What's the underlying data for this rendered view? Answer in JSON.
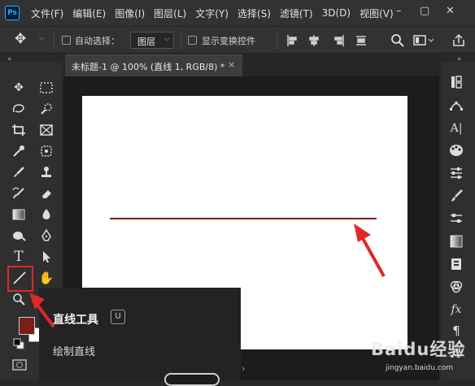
{
  "app": {
    "logo": "Ps"
  },
  "menu": {
    "items": [
      "文件(F)",
      "编辑(E)",
      "图像(I)",
      "图层(L)",
      "文字(Y)",
      "选择(S)",
      "滤镜(T)",
      "3D(D)",
      "视图(V)"
    ],
    "minimize": "–",
    "restore": "▢",
    "close": "✕"
  },
  "options": {
    "auto_select_label": "自动选择：",
    "layer_select_value": "图层",
    "show_transform_label": "显示变换控件"
  },
  "document": {
    "tab_title": "未标题-1 @ 100% (直线 1, RGB/8) *",
    "close_glyph": "×"
  },
  "tooltip": {
    "title": "直线工具",
    "shortcut": "U",
    "description": "绘制直线"
  },
  "colors": {
    "foreground": "#7b1e1a",
    "background": "#ffffff",
    "line": "#8b1a1a",
    "arrow": "#e02828"
  },
  "icons": {
    "left": [
      "move-icon",
      "marquee-icon",
      "lasso-icon",
      "quick-select-icon",
      "crop-icon",
      "frame-icon",
      "eyedropper-icon",
      "spot-heal-icon",
      "brush-icon",
      "stamp-icon",
      "history-brush-icon",
      "eraser-icon",
      "gradient-icon",
      "blur-icon",
      "dodge-icon",
      "pen-icon",
      "type-icon",
      "path-select-icon",
      "line-tool-icon",
      "hand-icon",
      "zoom-icon"
    ],
    "right": [
      "history-icon",
      "paths-icon",
      "character-icon",
      "color-icon",
      "adjust-icon",
      "brushes-icon",
      "properties-icon",
      "gradients-icon",
      "libraries-icon",
      "channels-icon",
      "fx-icon",
      "paragraph-icon",
      "glyphs-icon"
    ]
  },
  "watermark": {
    "text": "Baidu经验",
    "sub": "jingyan.baidu.com"
  }
}
